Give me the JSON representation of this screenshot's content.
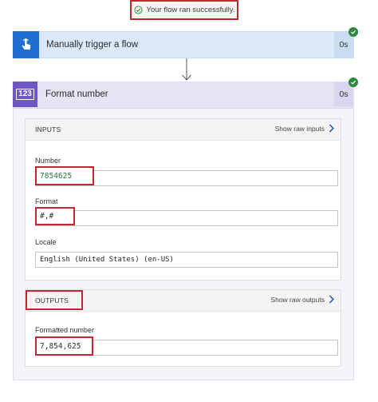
{
  "toast": {
    "message": "Your flow ran successfully."
  },
  "trigger": {
    "title": "Manually trigger a flow",
    "duration": "0s",
    "icon": "touch-hand-icon"
  },
  "action": {
    "icon_text": "123",
    "title": "Format number",
    "duration": "0s",
    "inputs": {
      "header": "INPUTS",
      "raw_link": "Show raw inputs",
      "number_label": "Number",
      "number_value": "7854625",
      "format_label": "Format",
      "format_value": "#,#",
      "locale_label": "Locale",
      "locale_value": "English (United States) (en-US)"
    },
    "outputs": {
      "header": "OUTPUTS",
      "raw_link": "Show raw outputs",
      "formatted_label": "Formatted number",
      "formatted_value": "7,854,625"
    }
  },
  "colors": {
    "success": "#2e8b3e",
    "highlight": "#c1272d",
    "trigger_accent": "#1f6fd0",
    "action_accent": "#6f56c2"
  }
}
